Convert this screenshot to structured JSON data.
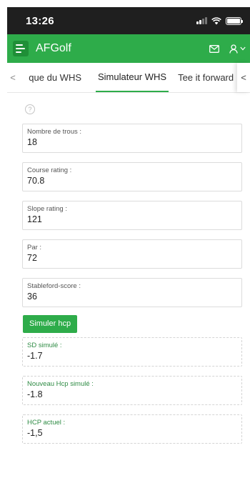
{
  "status": {
    "time": "13:26"
  },
  "app": {
    "title": "AFGolf"
  },
  "icons": {
    "menu": "menu-icon",
    "mail": "mail-icon",
    "user": "user-icon",
    "chevron": "chevron-down-icon",
    "help": "help-icon"
  },
  "colors": {
    "brand_green": "#2eac4a",
    "status_bar": "#1f1f1f"
  },
  "tabs": {
    "scroll_left": "<",
    "scroll_right": "<",
    "items": [
      {
        "label": "que du WHS"
      },
      {
        "label": "Simulateur WHS",
        "active": true
      },
      {
        "label": "Tee it forward"
      }
    ]
  },
  "form": {
    "help": "?",
    "fields": [
      {
        "label": "Nombre de trous :",
        "value": "18"
      },
      {
        "label": "Course rating :",
        "value": "70.8"
      },
      {
        "label": "Slope rating :",
        "value": "121"
      },
      {
        "label": "Par :",
        "value": "72"
      },
      {
        "label": "Stableford-score :",
        "value": "36"
      }
    ],
    "simulate_label": "Simuler hcp"
  },
  "results": [
    {
      "label": "SD simulé :",
      "value": "-1.7"
    },
    {
      "label": "Nouveau Hcp simulé :",
      "value": "-1.8"
    },
    {
      "label": "HCP actuel :",
      "value": "-1,5"
    }
  ]
}
